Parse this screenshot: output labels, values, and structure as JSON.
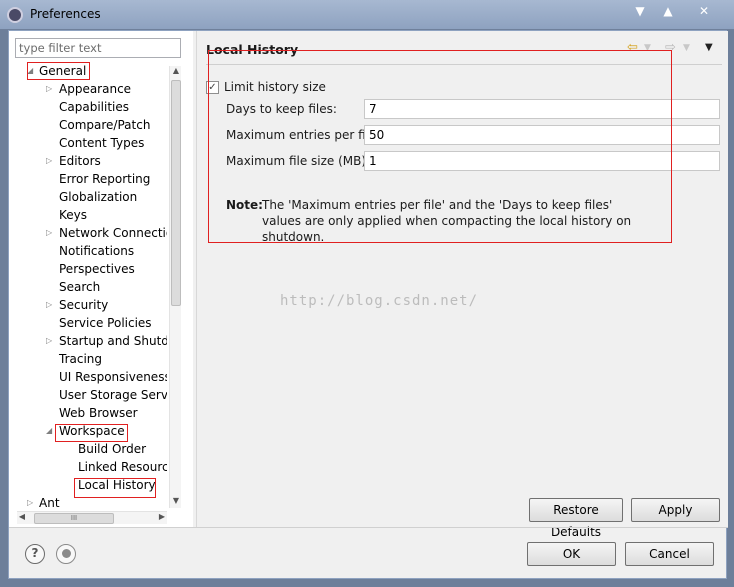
{
  "window": {
    "title": "Preferences",
    "controls": [
      "▼",
      "▲",
      "✕"
    ]
  },
  "left": {
    "filter_placeholder": "type filter text",
    "tree": [
      {
        "label": "General",
        "level": 0,
        "arrow": "expanded"
      },
      {
        "label": "Appearance",
        "level": 1,
        "arrow": "collapsed"
      },
      {
        "label": "Capabilities",
        "level": 1,
        "arrow": ""
      },
      {
        "label": "Compare/Patch",
        "level": 1,
        "arrow": ""
      },
      {
        "label": "Content Types",
        "level": 1,
        "arrow": ""
      },
      {
        "label": "Editors",
        "level": 1,
        "arrow": "collapsed"
      },
      {
        "label": "Error Reporting",
        "level": 1,
        "arrow": ""
      },
      {
        "label": "Globalization",
        "level": 1,
        "arrow": ""
      },
      {
        "label": "Keys",
        "level": 1,
        "arrow": ""
      },
      {
        "label": "Network Connection",
        "level": 1,
        "arrow": "collapsed"
      },
      {
        "label": "Notifications",
        "level": 1,
        "arrow": ""
      },
      {
        "label": "Perspectives",
        "level": 1,
        "arrow": ""
      },
      {
        "label": "Search",
        "level": 1,
        "arrow": ""
      },
      {
        "label": "Security",
        "level": 1,
        "arrow": "collapsed"
      },
      {
        "label": "Service Policies",
        "level": 1,
        "arrow": ""
      },
      {
        "label": "Startup and Shutdow",
        "level": 1,
        "arrow": "collapsed"
      },
      {
        "label": "Tracing",
        "level": 1,
        "arrow": ""
      },
      {
        "label": "UI Responsiveness M",
        "level": 1,
        "arrow": ""
      },
      {
        "label": "User Storage Service",
        "level": 1,
        "arrow": ""
      },
      {
        "label": "Web Browser",
        "level": 1,
        "arrow": ""
      },
      {
        "label": "Workspace",
        "level": 1,
        "arrow": "expanded"
      },
      {
        "label": "Build Order",
        "level": 2,
        "arrow": ""
      },
      {
        "label": "Linked Resource",
        "level": 2,
        "arrow": ""
      },
      {
        "label": "Local History",
        "level": 2,
        "arrow": "",
        "selected": true
      },
      {
        "label": "Ant",
        "level": 0,
        "arrow": "collapsed"
      }
    ],
    "hscroll_thumb_glyph": "III"
  },
  "page": {
    "title": "Local History",
    "nav_back": "⇦",
    "nav_forward": "⇨",
    "nav_menu": "▼",
    "limit_checkbox": {
      "label": "Limit history size",
      "checked": true,
      "mark": "✓"
    },
    "fields": [
      {
        "label": "Days to keep files:",
        "value": "7"
      },
      {
        "label": "Maximum entries per file:",
        "value": "50"
      },
      {
        "label": "Maximum file size (MB):",
        "value": "1"
      }
    ],
    "note_label": "Note:",
    "note_text": "The 'Maximum entries per file' and the 'Days to keep files' values are only applied when compacting the local history on shutdown.",
    "watermark": "http://blog.csdn.net/",
    "restore_defaults": "Restore Defaults",
    "apply": "Apply"
  },
  "footer": {
    "help_glyph": "?",
    "ok": "OK",
    "cancel": "Cancel"
  },
  "colors": {
    "annotation": "#e02020",
    "titlebar": "#8ea2c0"
  }
}
